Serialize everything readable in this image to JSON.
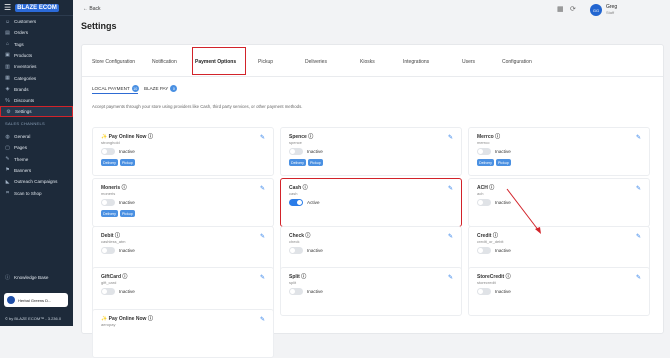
{
  "sidebar": {
    "brand": "BLAZE ECOM",
    "items": [
      {
        "label": "Customers",
        "icon": "people-icon"
      },
      {
        "label": "Orders",
        "icon": "receipt-icon"
      },
      {
        "label": "Tags",
        "icon": "tag-icon"
      },
      {
        "label": "Products",
        "icon": "box-icon"
      },
      {
        "label": "Inventories",
        "icon": "clipboard-icon"
      },
      {
        "label": "Categories",
        "icon": "categories-icon"
      },
      {
        "label": "Brands",
        "icon": "brand-icon"
      },
      {
        "label": "Discounts",
        "icon": "percent-icon"
      },
      {
        "label": "Settings",
        "icon": "gear-icon"
      }
    ],
    "section": "SALES CHANNELS",
    "channels": [
      {
        "label": "General",
        "icon": "globe-icon"
      },
      {
        "label": "Pages",
        "icon": "page-icon"
      },
      {
        "label": "Theme",
        "icon": "brush-icon"
      },
      {
        "label": "Banners",
        "icon": "flag-icon"
      },
      {
        "label": "Outreach Campaigns",
        "icon": "megaphone-icon"
      },
      {
        "label": "Scan to Shop",
        "icon": "scan-icon"
      }
    ],
    "knowledge": "Knowledge Base",
    "store": "Herbal Greens D...",
    "version": "© by BLAZE ECOM™ - 3.236.0"
  },
  "header": {
    "back": "Back",
    "title": "Settings",
    "user_name": "Greg",
    "user_role": "Staff",
    "user_initials": "GG"
  },
  "tabs": [
    "Store Configuration",
    "Notification",
    "Payment Options",
    "Pickup",
    "Deliveries",
    "Kiosks",
    "Integrations",
    "Users",
    "Configuration"
  ],
  "subtabs": [
    {
      "label": "LOCAL PAYMENT",
      "count": "10"
    },
    {
      "label": "BLAZE PAY",
      "count": "0"
    }
  ],
  "description": "Accept payments through your store using providers like Cash, third party services, or other payment methods.",
  "cards": [
    {
      "name": "Pay Online Now",
      "code": "stronghold",
      "status": "Inactive",
      "chips": [
        "Delivery",
        "Pickup"
      ]
    },
    {
      "name": "Spence",
      "code": "spence",
      "status": "Inactive",
      "chips": [
        "Delivery",
        "Pickup"
      ]
    },
    {
      "name": "Merrco",
      "code": "merrco",
      "status": "Inactive",
      "chips": [
        "Delivery",
        "Pickup"
      ]
    },
    {
      "name": "Moneris",
      "code": "moneris",
      "status": "Inactive",
      "chips": [
        "Delivery",
        "Pickup"
      ]
    },
    {
      "name": "Cash",
      "code": "cash",
      "status": "Active",
      "chips": []
    },
    {
      "name": "ACH",
      "code": "ach",
      "status": "Inactive",
      "chips": []
    },
    {
      "name": "Debit",
      "code": "cashless_atm",
      "status": "Inactive",
      "chips": []
    },
    {
      "name": "Check",
      "code": "check",
      "status": "Inactive",
      "chips": []
    },
    {
      "name": "Credit",
      "code": "credit_or_debit",
      "status": "Inactive",
      "chips": []
    },
    {
      "name": "GiftCard",
      "code": "gift_card",
      "status": "Inactive",
      "chips": []
    },
    {
      "name": "Split",
      "code": "split",
      "status": "Inactive",
      "chips": []
    },
    {
      "name": "StoreCredit",
      "code": "storecredit",
      "status": "Inactive",
      "chips": []
    },
    {
      "name": "Pay Online Now",
      "code": "aeropay",
      "status": "",
      "chips": []
    }
  ]
}
